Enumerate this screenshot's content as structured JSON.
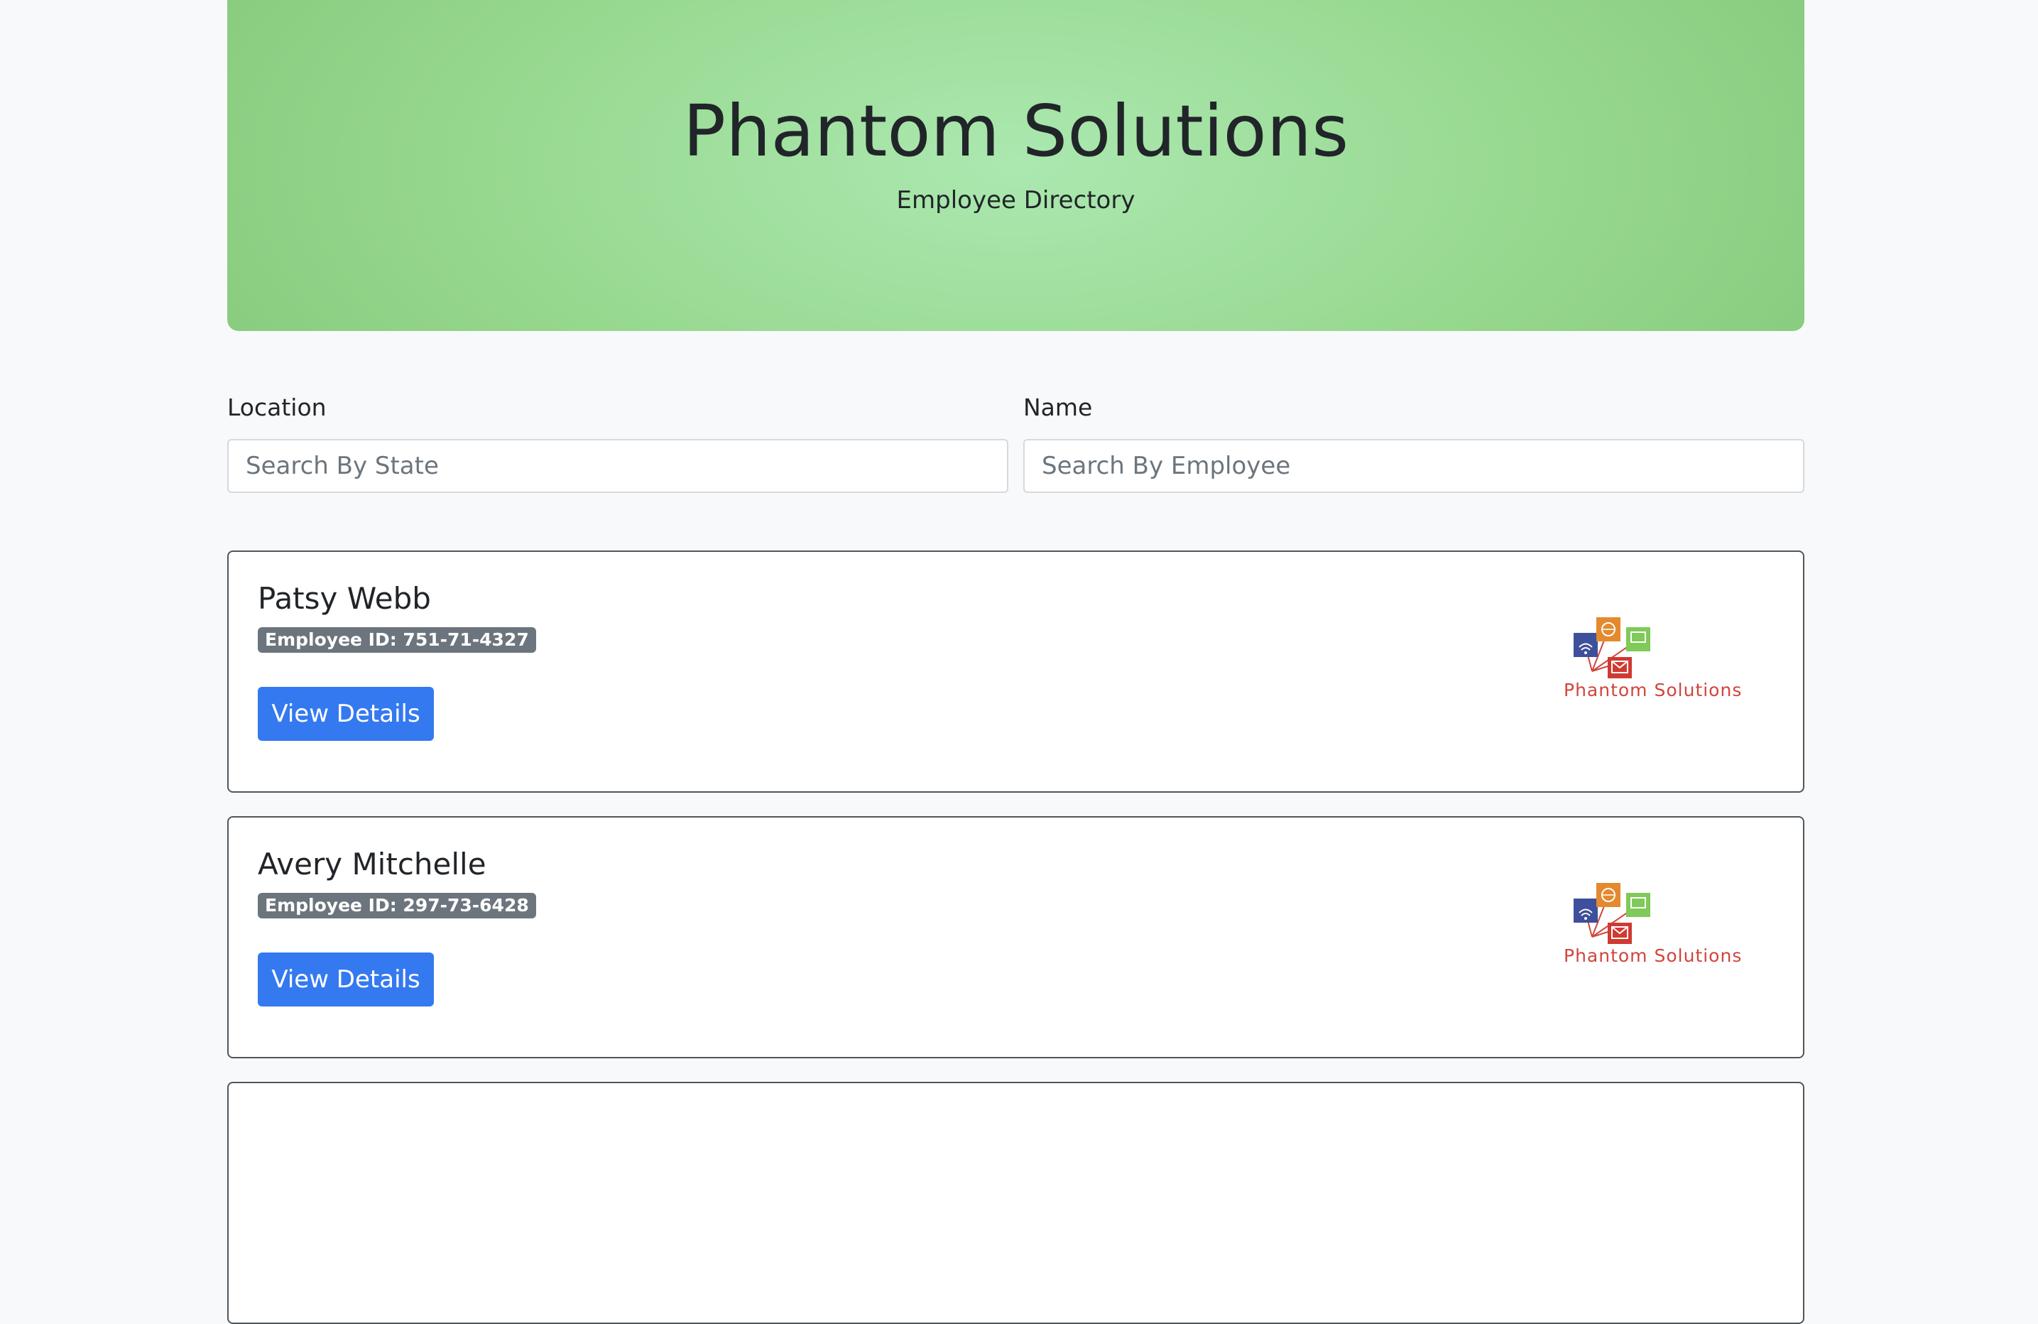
{
  "header": {
    "title": "Phantom Solutions",
    "subtitle": "Employee Directory"
  },
  "filters": {
    "location": {
      "label": "Location",
      "placeholder": "Search By State",
      "value": ""
    },
    "name": {
      "label": "Name",
      "placeholder": "Search By Employee",
      "value": ""
    }
  },
  "employees": [
    {
      "name": "Patsy Webb",
      "id_label": "Employee ID: 751-71-4327",
      "button_label": "View Details",
      "logo_text": "Phantom Solutions"
    },
    {
      "name": "Avery Mitchelle",
      "id_label": "Employee ID: 297-73-6428",
      "button_label": "View Details",
      "logo_text": "Phantom Solutions"
    }
  ],
  "colors": {
    "accent": "#3479f0",
    "badge": "#6c757d",
    "hero_light": "#abe8b0",
    "hero_dark": "#7cc070",
    "logo_red": "#d0453c"
  },
  "icons": {
    "logo": "phantom-solutions-logo-icon"
  }
}
